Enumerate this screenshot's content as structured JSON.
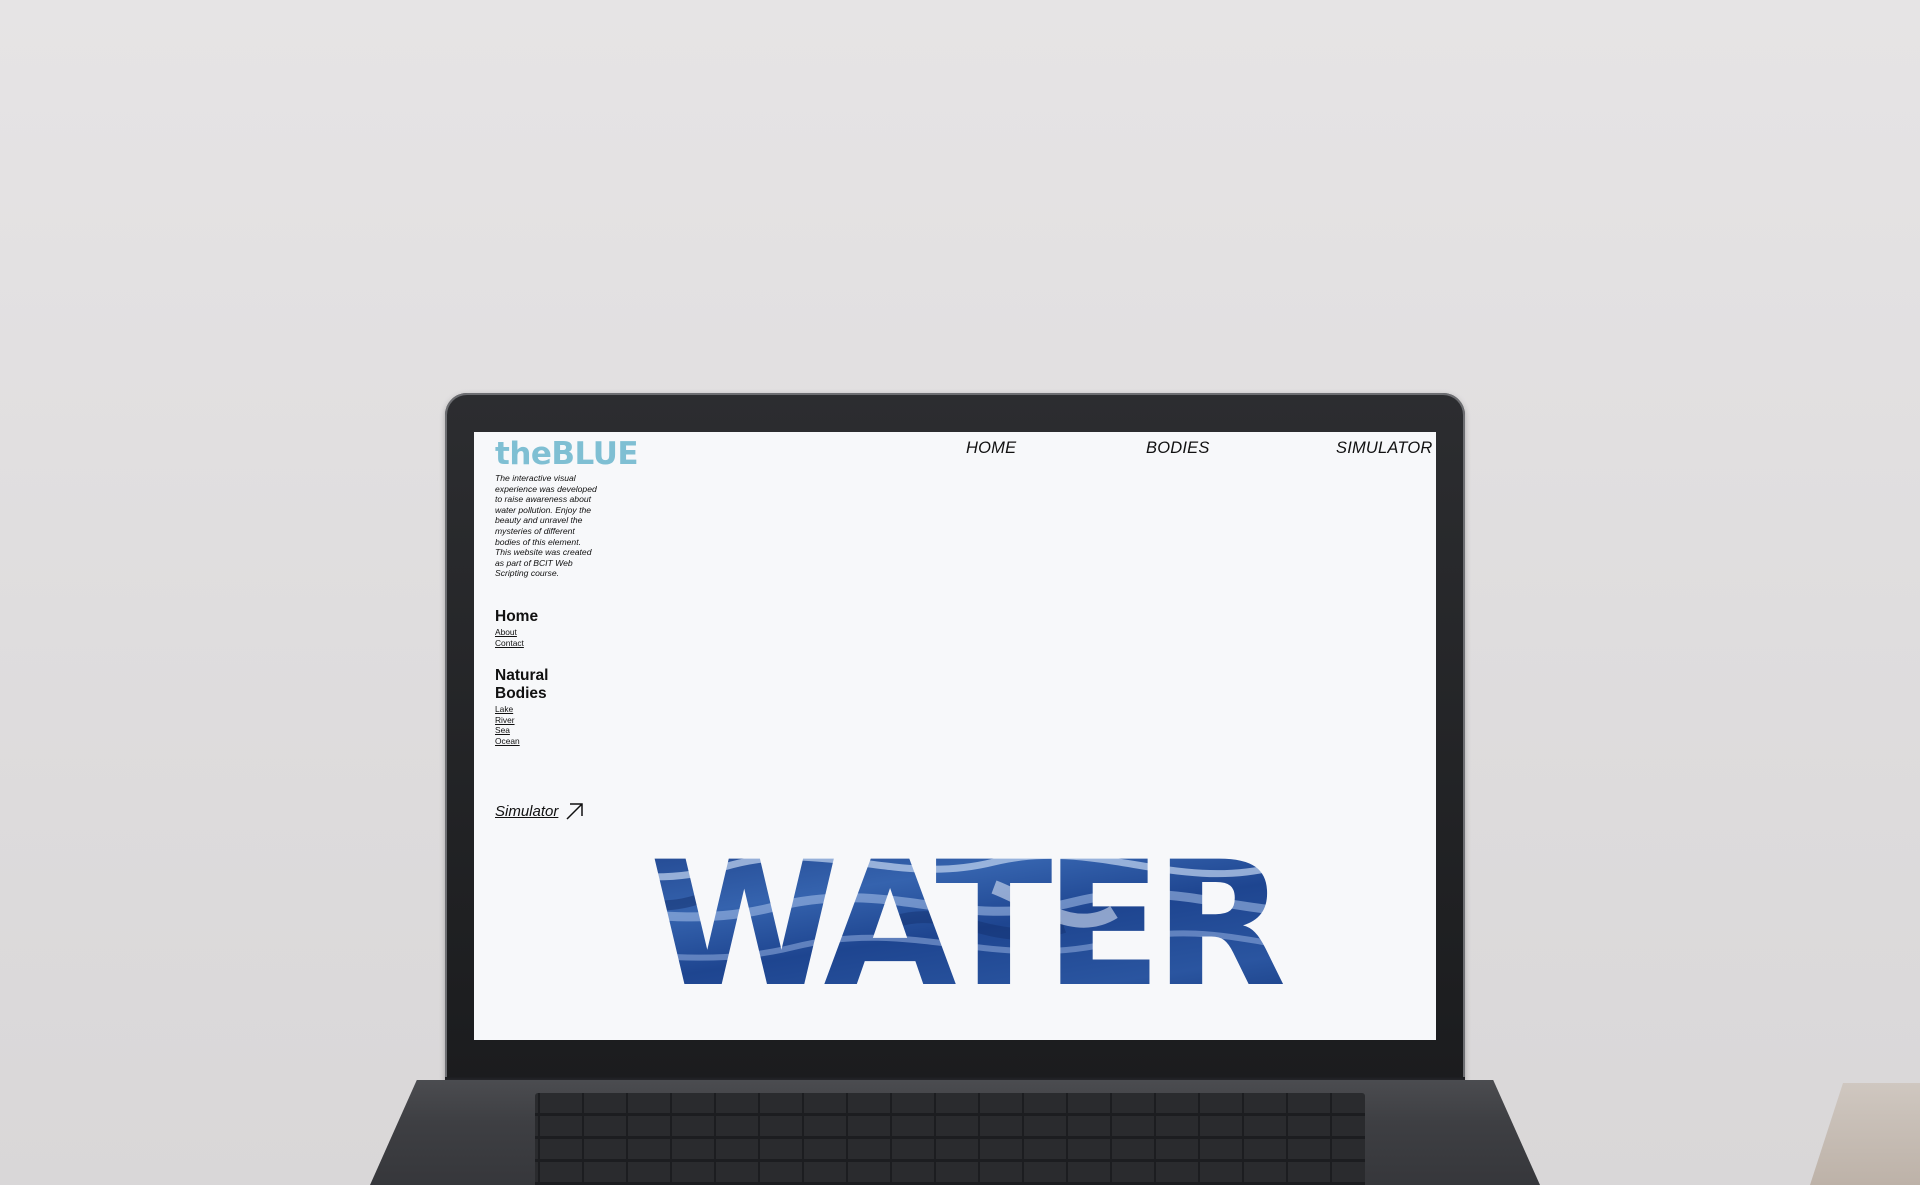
{
  "site": {
    "logo": "theBLUE",
    "tagline": "The interactive visual experience was developed to raise awareness about water pollution. Enjoy the beauty and unravel the mysteries of different bodies of this element. This website was created as part of BCIT Web Scripting course."
  },
  "top_nav": [
    {
      "label": "HOME"
    },
    {
      "label": "BODIES"
    },
    {
      "label": "SIMULATOR"
    }
  ],
  "sidebar": {
    "groups": [
      {
        "title": "Home",
        "links": [
          "About",
          "Contact"
        ]
      },
      {
        "title": "Natural Bodies",
        "links": [
          "Lake",
          "River",
          "Sea",
          "Ocean"
        ]
      }
    ],
    "simulator_link": "Simulator",
    "simulator_icon": "arrow-up-right-icon"
  },
  "hero": {
    "word": "WATER",
    "fill": "water-texture"
  },
  "colors": {
    "logo": "#7fbfd3",
    "text": "#111111",
    "water_dark": "#1c3f86",
    "water_mid": "#2e5ca8",
    "water_light": "#bcd0ee",
    "screen_bg": "#f7f8fa"
  }
}
